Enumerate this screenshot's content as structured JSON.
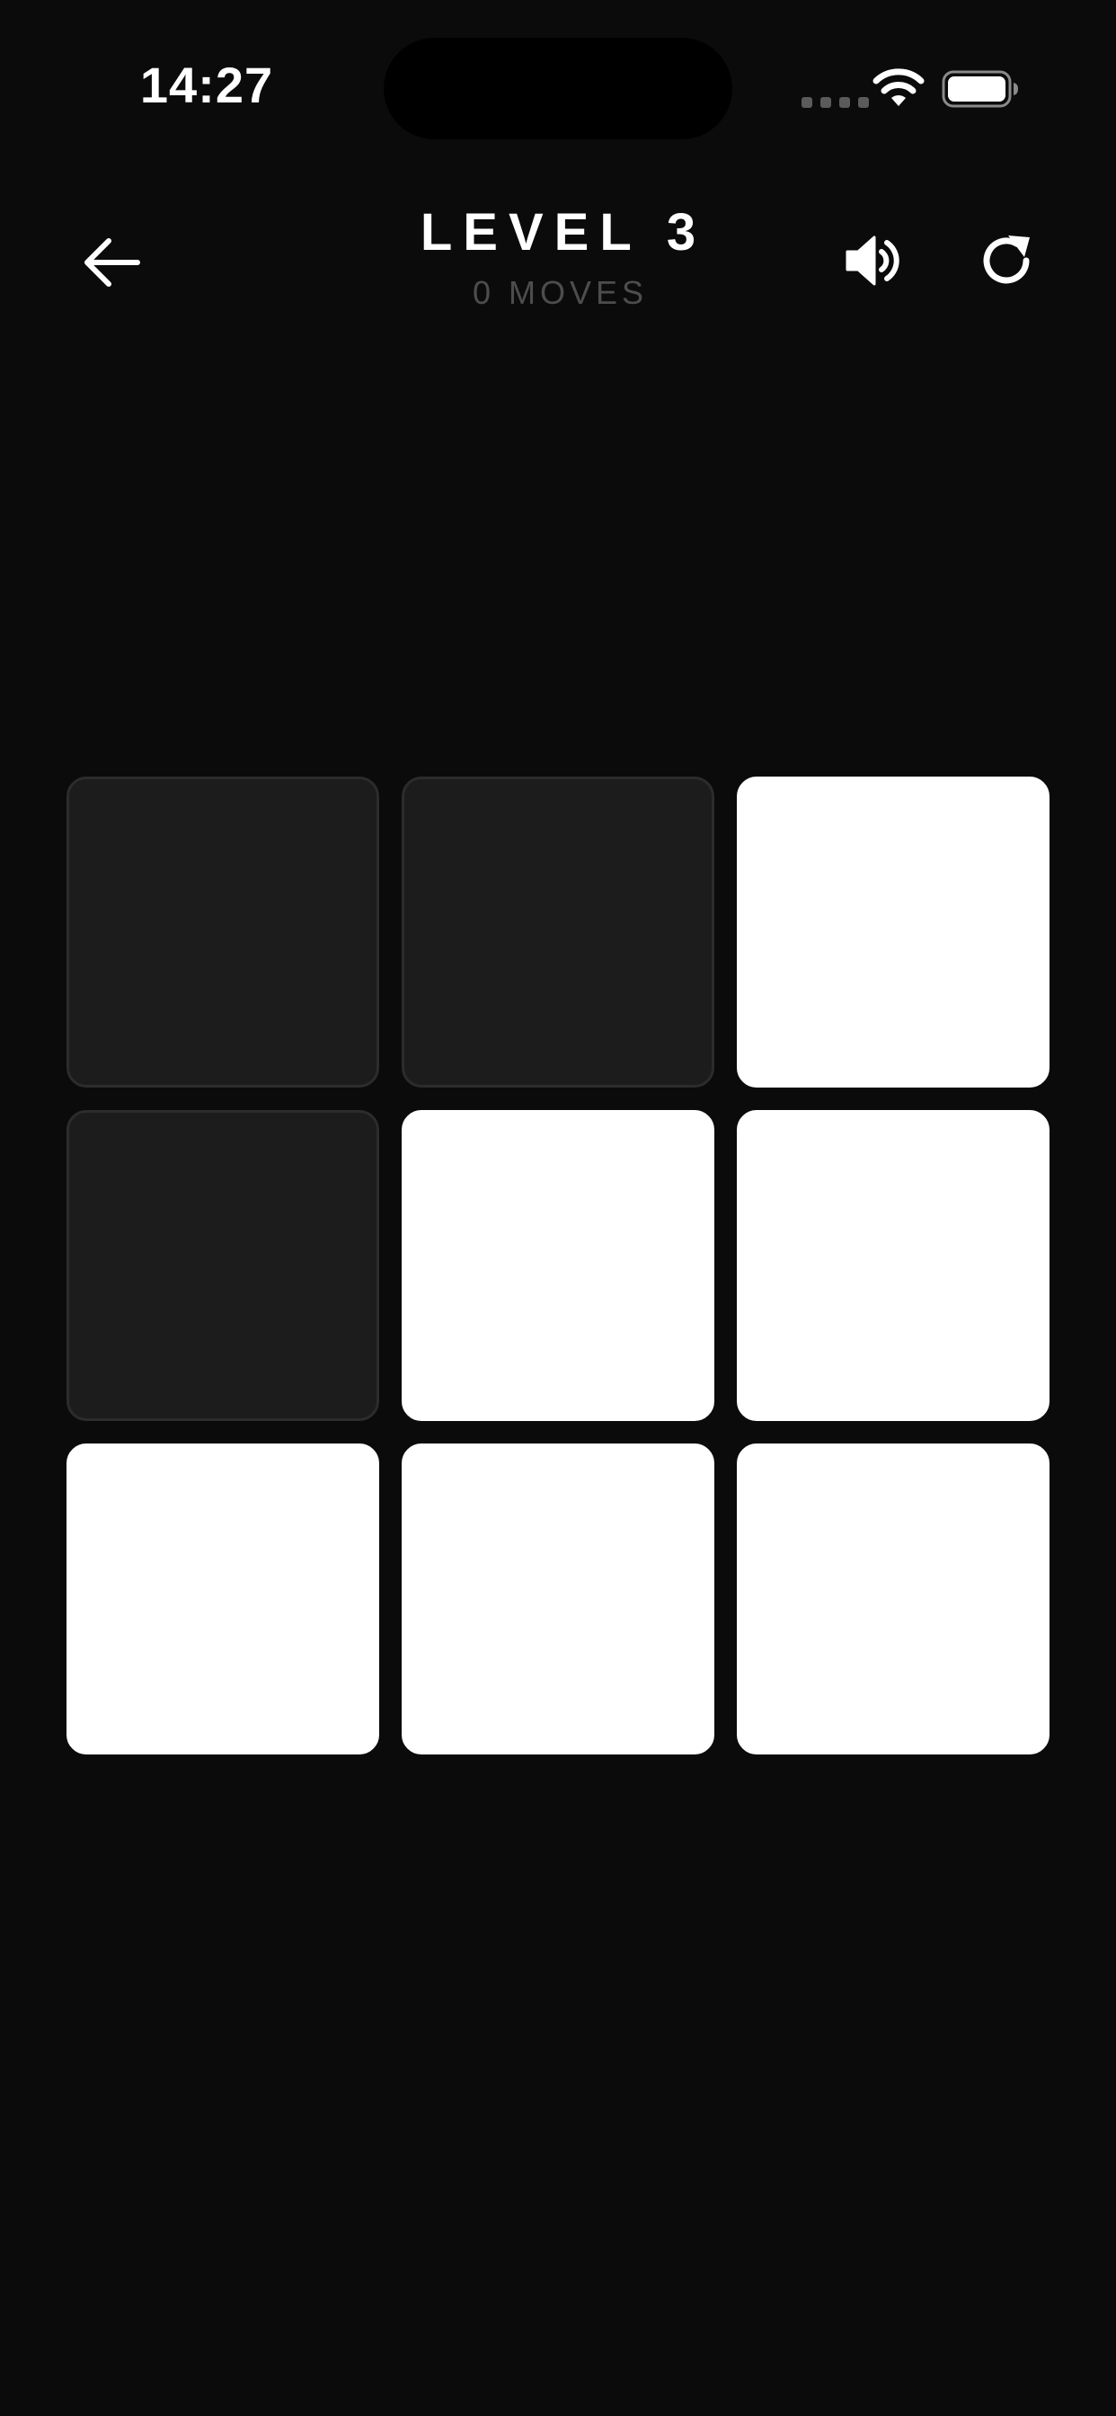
{
  "status_bar": {
    "time": "14:27",
    "icons": [
      "cellular-dots-icon",
      "wifi-icon",
      "battery-icon"
    ]
  },
  "header": {
    "title": "LEVEL 3",
    "moves_count": "0",
    "moves_suffix": "MOVES",
    "icons": {
      "back": "arrow-left-icon",
      "sound": "speaker-icon",
      "restart": "restart-icon"
    }
  },
  "board": {
    "rows": 3,
    "cols": 3,
    "tiles": [
      [
        false,
        false,
        true
      ],
      [
        false,
        true,
        true
      ],
      [
        true,
        true,
        true
      ]
    ]
  },
  "colors": {
    "background": "#0b0b0b",
    "tile_on": "#ffffff",
    "tile_off": "#1c1c1c",
    "tile_off_border": "#2c2c2c",
    "muted_text": "#4d4d4d"
  }
}
